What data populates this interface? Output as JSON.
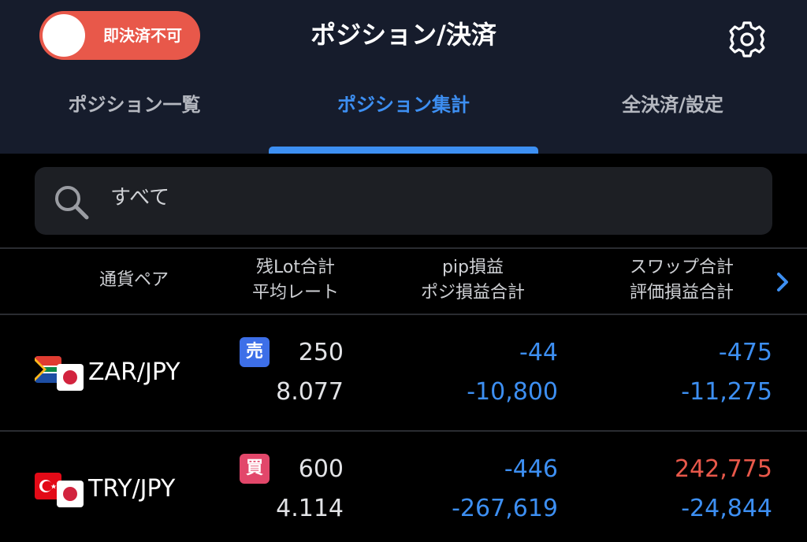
{
  "header": {
    "toggle_label": "即決済不可",
    "title": "ポジション/決済",
    "settings_icon": "gear-icon"
  },
  "tabs": [
    {
      "label": "ポジション一覧",
      "active": false
    },
    {
      "label": "ポジション集計",
      "active": true
    },
    {
      "label": "全決済/設定",
      "active": false
    }
  ],
  "search": {
    "value": "すべて",
    "icon": "search-icon"
  },
  "columns": {
    "pair": "通貨ペア",
    "lot_line1": "残Lot合計",
    "lot_line2": "平均レート",
    "pip_line1": "pip損益",
    "pip_line2": "ポジ損益合計",
    "swap_line1": "スワップ合計",
    "swap_line2": "評価損益合計",
    "next_icon": "chevron-right-icon"
  },
  "rows": [
    {
      "pair": "ZAR/JPY",
      "flag": "south-africa-flag-icon",
      "side": "売",
      "lot": "250",
      "avg_rate": "8.077",
      "pip": "-44",
      "pos_pl": "-10,800",
      "swap": "-475",
      "eval_pl": "-11,275"
    },
    {
      "pair": "TRY/JPY",
      "flag": "turkey-flag-icon",
      "side": "買",
      "lot": "600",
      "avg_rate": "4.114",
      "pip": "-446",
      "pos_pl": "-267,619",
      "swap": "242,775",
      "eval_pl": "-24,844"
    }
  ],
  "colors": {
    "accent": "#3d8ff2",
    "negative": "#3d8ff2",
    "positive": "#e8584a",
    "sell_badge": "#3d6fe8",
    "buy_badge": "#e2476a",
    "toggle": "#e8584a"
  }
}
